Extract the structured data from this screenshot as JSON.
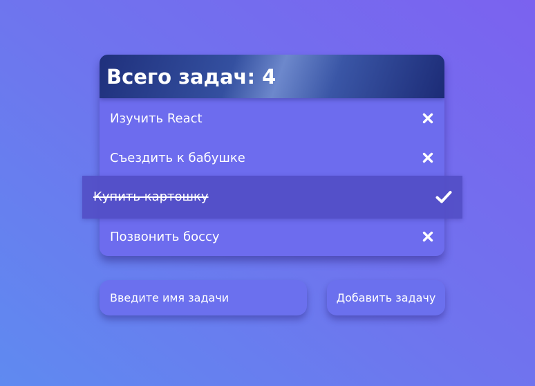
{
  "header": {
    "title": "Всего задач: 4"
  },
  "tasks": [
    {
      "label": "Изучить React",
      "completed": false,
      "action_icon": "close-icon"
    },
    {
      "label": "Съездить к бабушке",
      "completed": false,
      "action_icon": "close-icon"
    },
    {
      "label": "Купить картошку",
      "completed": true,
      "action_icon": "check-icon"
    },
    {
      "label": "Позвонить боссу",
      "completed": false,
      "action_icon": "close-icon"
    }
  ],
  "form": {
    "input_placeholder": "Введите имя задачи",
    "input_value": "",
    "add_button_label": "Добавить задачу"
  },
  "colors": {
    "background_start": "#5f8af0",
    "background_end": "#7b62ef",
    "card": "#6d6cee",
    "header_dark": "#1f307c",
    "completed_row": "#524ec6",
    "text": "#ffffff"
  }
}
